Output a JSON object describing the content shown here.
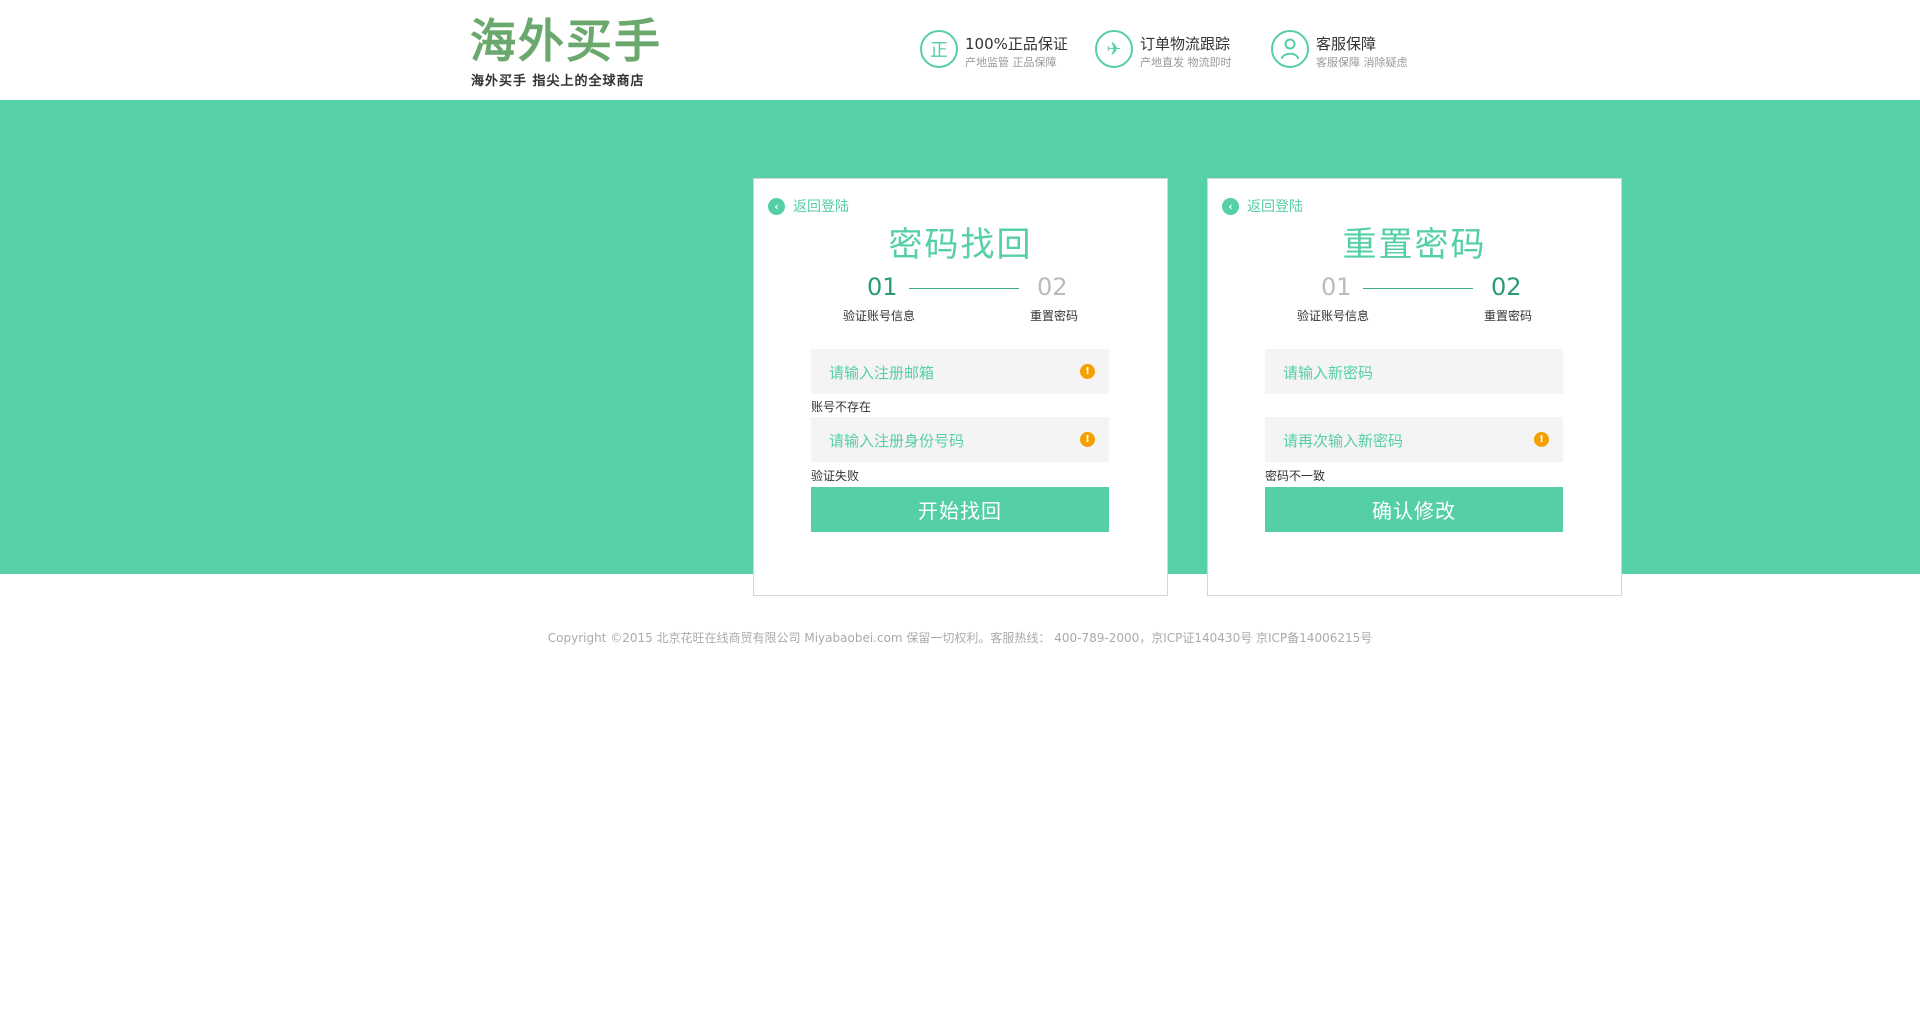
{
  "header": {
    "logo_main": "海外买手",
    "logo_sub": "海外买手  指尖上的全球商店",
    "features": [
      {
        "icon": "genuine-icon",
        "icon_glyph": "正",
        "title": "100%正品保证",
        "sub": "产地监管  正品保障"
      },
      {
        "icon": "airplane-icon",
        "icon_glyph": "✈",
        "title": "订单物流跟踪",
        "sub": "产地直发 物流即时"
      },
      {
        "icon": "user-icon",
        "icon_glyph": "●",
        "title": "客服保障",
        "sub": "客服保障 消除疑虑"
      }
    ]
  },
  "recover_card": {
    "back_label": "返回登陆",
    "title": "密码找回",
    "step1_num": "01",
    "step2_num": "02",
    "step1_label": "验证账号信息",
    "step2_label": "重置密码",
    "email_placeholder": "请输入注册邮箱",
    "email_error": "账号不存在",
    "id_placeholder": "请输入注册身份号码",
    "id_error": "验证失败",
    "submit_label": "开始找回"
  },
  "reset_card": {
    "back_label": "返回登陆",
    "title": "重置密码",
    "step1_num": "01",
    "step2_num": "02",
    "step1_label": "验证账号信息",
    "step2_label": "重置密码",
    "new_password_placeholder": "请输入新密码",
    "confirm_password_placeholder": "请再次输入新密码",
    "confirm_error": "密码不一致",
    "submit_label": "确认修改"
  },
  "footer": {
    "copyright": "Copyright ©2015 北京花旺在线商贸有限公司 Miyabaobei.com 保留一切权利。客服热线： 400-789-2000，京ICP证140430号 京ICP备14006215号"
  },
  "colors": {
    "brand_green": "#55d1a5",
    "logo_green": "#6aa86e",
    "warning_orange": "#f5a000"
  }
}
